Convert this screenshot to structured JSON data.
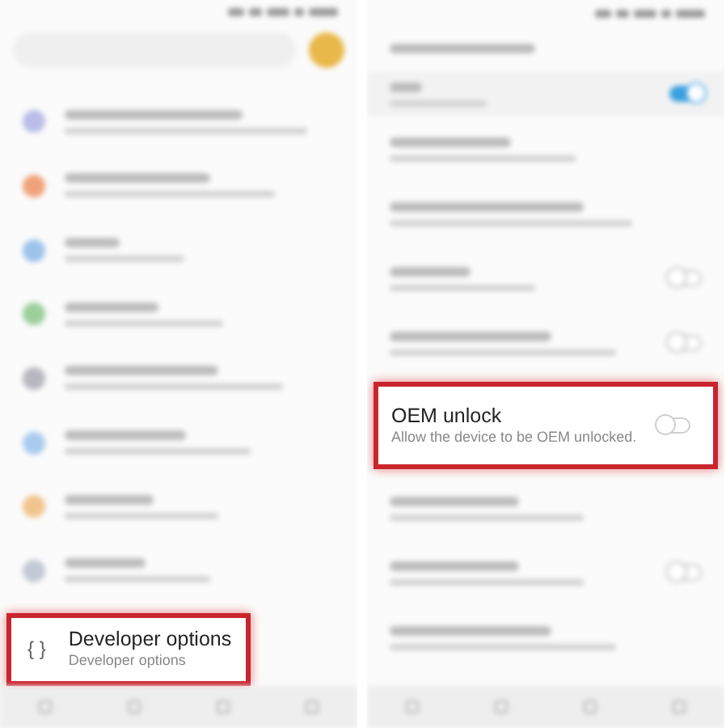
{
  "settings_screen": {
    "items": [
      {
        "kind": "blurred",
        "color": "#b9bde8"
      },
      {
        "kind": "blurred",
        "color": "#f0a27a"
      },
      {
        "kind": "blurred",
        "color": "#9cc3ea"
      },
      {
        "kind": "blurred",
        "color": "#9ccf9a"
      },
      {
        "kind": "blurred",
        "color": "#b7b7bf"
      },
      {
        "kind": "blurred",
        "color": "#a9cbee"
      },
      {
        "kind": "blurred",
        "color": "#f2c48e"
      },
      {
        "kind": "blurred",
        "color": "#c3c8d6"
      },
      {
        "kind": "highlighted",
        "icon": "{ }",
        "title": "Developer options",
        "subtitle": "Developer options"
      }
    ]
  },
  "developer_screen": {
    "items": [
      {
        "kind": "blurred-master-switch",
        "on": true
      },
      {
        "kind": "blurred"
      },
      {
        "kind": "blurred"
      },
      {
        "kind": "blurred-switch",
        "on": false
      },
      {
        "kind": "blurred-switch",
        "on": false
      },
      {
        "kind": "highlighted-switch",
        "on": false,
        "title": "OEM unlock",
        "subtitle": "Allow the device to be OEM unlocked."
      },
      {
        "kind": "blurred"
      },
      {
        "kind": "blurred-switch",
        "on": false
      },
      {
        "kind": "blurred"
      }
    ]
  }
}
